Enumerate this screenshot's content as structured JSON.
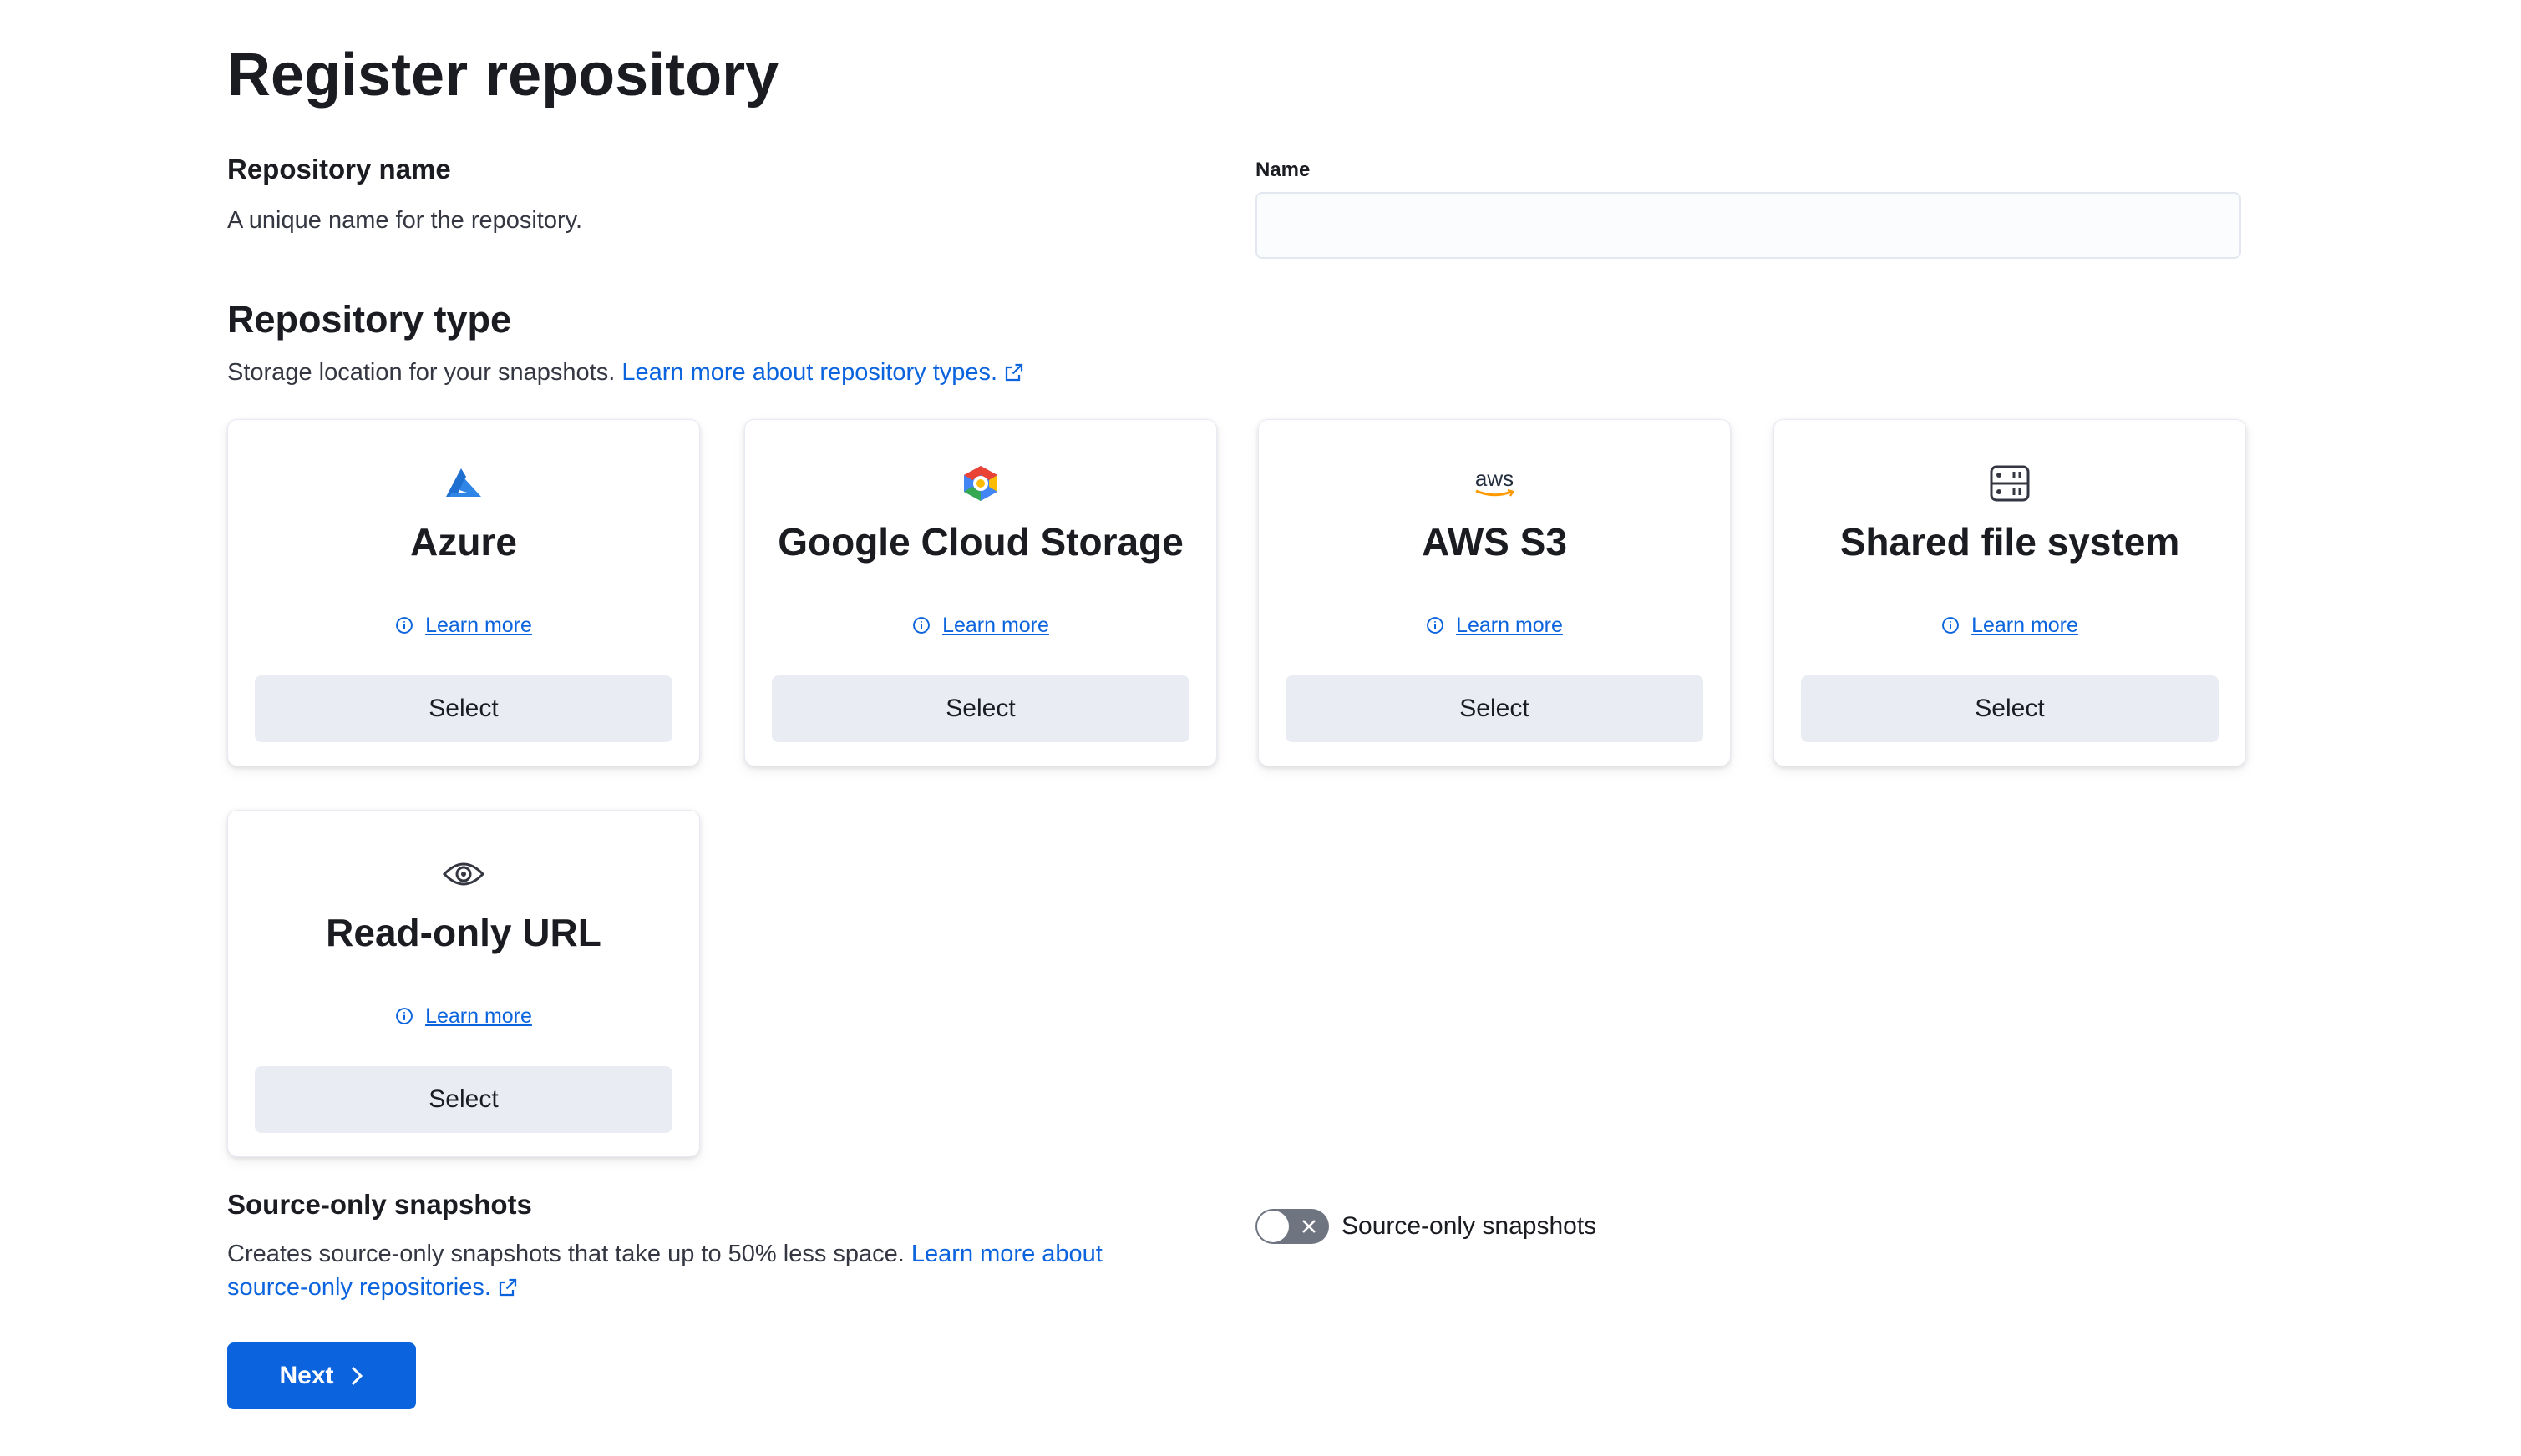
{
  "page": {
    "title": "Register repository"
  },
  "repository_name": {
    "heading": "Repository name",
    "description": "A unique name for the repository.",
    "field_label": "Name",
    "value": "",
    "placeholder": ""
  },
  "repository_type": {
    "heading": "Repository type",
    "description": "Storage location for your snapshots.",
    "link_text": "Learn more about repository types.",
    "cards": [
      {
        "title": "Azure",
        "icon": "azure-icon",
        "learn_more": "Learn more",
        "select_label": "Select"
      },
      {
        "title": "Google Cloud Storage",
        "icon": "google-cloud-icon",
        "learn_more": "Learn more",
        "select_label": "Select"
      },
      {
        "title": "AWS S3",
        "icon": "aws-icon",
        "icon_text": "aws",
        "learn_more": "Learn more",
        "select_label": "Select"
      },
      {
        "title": "Shared file system",
        "icon": "storage-icon",
        "learn_more": "Learn more",
        "select_label": "Select"
      },
      {
        "title": "Read-only URL",
        "icon": "eye-icon",
        "learn_more": "Learn more",
        "select_label": "Select"
      }
    ]
  },
  "source_only": {
    "heading": "Source-only snapshots",
    "description": "Creates source-only snapshots that take up to 50% less space.",
    "link_text_line1": "Learn more about",
    "link_text_line2": "source-only repositories.",
    "toggle_label": "Source-only snapshots",
    "toggle_on": false
  },
  "footer": {
    "next_label": "Next"
  },
  "colors": {
    "primary": "#0b64dd",
    "select_bg": "#e9edf3",
    "toggle_off": "#6e7581"
  }
}
